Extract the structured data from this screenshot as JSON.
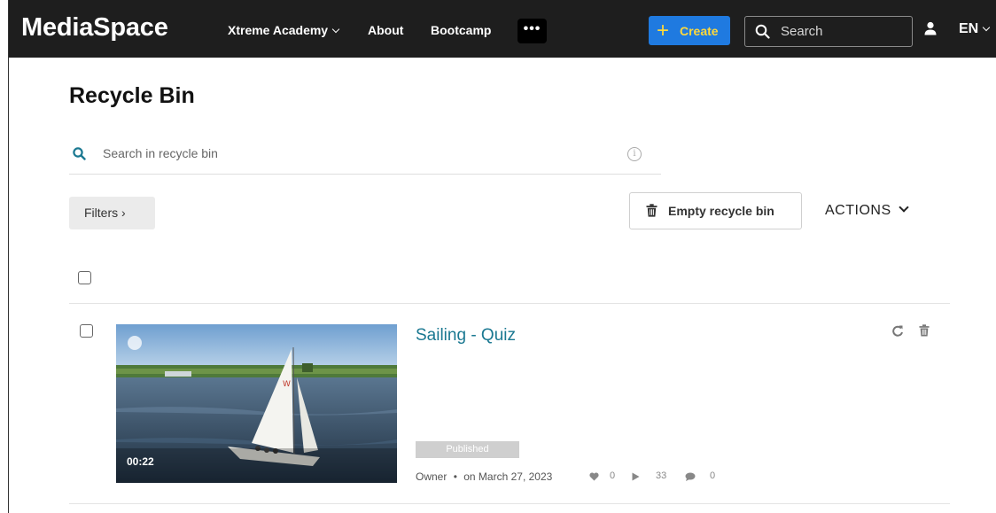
{
  "header": {
    "brand": "MediaSpace",
    "nav": [
      "Xtreme Academy",
      "About",
      "Bootcamp"
    ],
    "more_label": "•••",
    "create_label": "Create",
    "search_placeholder": "Search",
    "language": "EN",
    "icons": [
      "chevron-down-icon",
      "more-icon",
      "plus-icon",
      "search-icon",
      "user-icon"
    ]
  },
  "page": {
    "title": "Recycle Bin",
    "search_placeholder": "Search in recycle bin",
    "filters_label": "Filters ›",
    "empty_label": "Empty recycle bin",
    "actions_label": "ACTIONS"
  },
  "entries": [
    {
      "title": "Sailing - Quiz",
      "duration": "00:22",
      "status": "Published",
      "owner": "Owner",
      "date": "on March 27, 2023",
      "likes": "0",
      "plays": "33",
      "comments": "0"
    }
  ],
  "colors": {
    "header_bg": "#1e1e1e",
    "create_bg": "#1f7ae0",
    "create_text": "#ffd93b",
    "title_link": "#1a7891",
    "badge_bg": "#cfcfcf"
  }
}
